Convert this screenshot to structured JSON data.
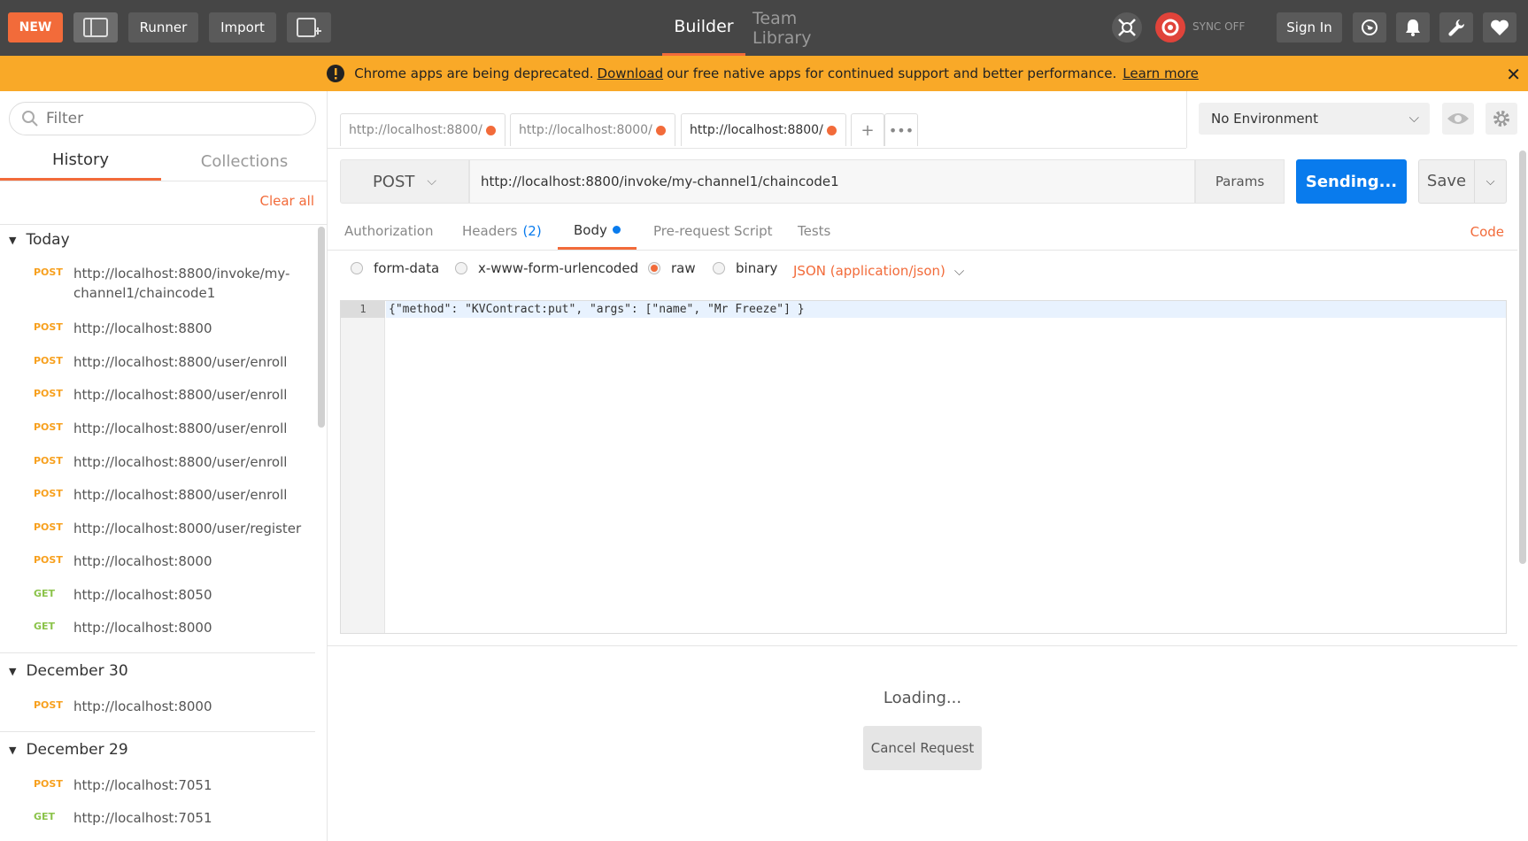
{
  "toolbar": {
    "new_label": "NEW",
    "runner_label": "Runner",
    "import_label": "Import",
    "builder_label": "Builder",
    "team_library_label": "Team Library",
    "sync_label": "SYNC OFF",
    "sign_in_label": "Sign In"
  },
  "banner": {
    "text_before": "Chrome apps are being deprecated.",
    "download_link": "Download",
    "text_after": "our free native apps for continued support and better performance.",
    "learn_more_link": "Learn more"
  },
  "sidebar": {
    "filter_placeholder": "Filter",
    "tab_history": "History",
    "tab_collections": "Collections",
    "clear_all": "Clear all",
    "groups": [
      {
        "title": "Today",
        "items": [
          {
            "method": "POST",
            "url": "http://localhost:8800/invoke/my-channel1/chaincode1"
          },
          {
            "method": "POST",
            "url": "http://localhost:8800"
          },
          {
            "method": "POST",
            "url": "http://localhost:8800/user/enroll"
          },
          {
            "method": "POST",
            "url": "http://localhost:8800/user/enroll"
          },
          {
            "method": "POST",
            "url": "http://localhost:8800/user/enroll"
          },
          {
            "method": "POST",
            "url": "http://localhost:8800/user/enroll"
          },
          {
            "method": "POST",
            "url": "http://localhost:8800/user/enroll"
          },
          {
            "method": "POST",
            "url": "http://localhost:8000/user/register"
          },
          {
            "method": "POST",
            "url": "http://localhost:8000"
          },
          {
            "method": "GET",
            "url": "http://localhost:8050"
          },
          {
            "method": "GET",
            "url": "http://localhost:8000"
          }
        ]
      },
      {
        "title": "December 30",
        "items": [
          {
            "method": "POST",
            "url": "http://localhost:8000"
          }
        ]
      },
      {
        "title": "December 29",
        "items": [
          {
            "method": "POST",
            "url": "http://localhost:7051"
          },
          {
            "method": "GET",
            "url": "http://localhost:7051"
          }
        ]
      }
    ]
  },
  "tabs": [
    {
      "label": "http://localhost:8800/"
    },
    {
      "label": "http://localhost:8000/"
    },
    {
      "label": "http://localhost:8800/"
    }
  ],
  "environment": {
    "selected": "No Environment"
  },
  "request": {
    "method": "POST",
    "url": "http://localhost:8800/invoke/my-channel1/chaincode1",
    "params_label": "Params",
    "send_label": "Sending...",
    "save_label": "Save",
    "tabs": {
      "authorization": "Authorization",
      "headers": "Headers",
      "headers_count": "(2)",
      "body": "Body",
      "prerequest": "Pre-request Script",
      "tests": "Tests"
    },
    "code_link": "Code",
    "body_types": {
      "form_data": "form-data",
      "urlencoded": "x-www-form-urlencoded",
      "raw": "raw",
      "binary": "binary"
    },
    "content_type": "JSON (application/json)",
    "editor": {
      "line_number": "1",
      "line_text": "{\"method\": \"KVContract:put\", \"args\": [\"name\", \"Mr Freeze\"] }"
    }
  },
  "response": {
    "loading_text": "Loading...",
    "cancel_label": "Cancel Request"
  },
  "colors": {
    "accent": "#f26b3a",
    "banner": "#f9a928",
    "primary": "#097bed",
    "topbar": "#464646"
  }
}
